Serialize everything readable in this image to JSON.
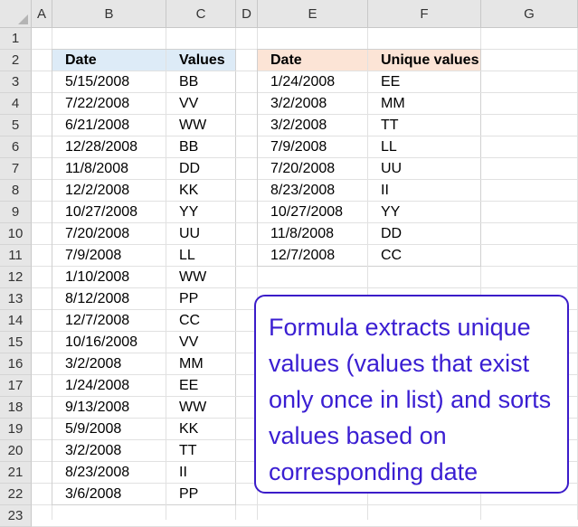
{
  "columns": [
    "A",
    "B",
    "C",
    "D",
    "E",
    "F",
    "G"
  ],
  "rows": [
    "1",
    "2",
    "3",
    "4",
    "5",
    "6",
    "7",
    "8",
    "9",
    "10",
    "11",
    "12",
    "13",
    "14",
    "15",
    "16",
    "17",
    "18",
    "19",
    "20",
    "21",
    "22",
    "23"
  ],
  "table1": {
    "headers": [
      "Date",
      "Values"
    ],
    "header_color": "#ddebf7",
    "rows": [
      [
        "5/15/2008",
        "BB"
      ],
      [
        "7/22/2008",
        "VV"
      ],
      [
        "6/21/2008",
        "WW"
      ],
      [
        "12/28/2008",
        "BB"
      ],
      [
        "11/8/2008",
        "DD"
      ],
      [
        "12/2/2008",
        "KK"
      ],
      [
        "10/27/2008",
        "YY"
      ],
      [
        "7/20/2008",
        "UU"
      ],
      [
        "7/9/2008",
        "LL"
      ],
      [
        "1/10/2008",
        "WW"
      ],
      [
        "8/12/2008",
        "PP"
      ],
      [
        "12/7/2008",
        "CC"
      ],
      [
        "10/16/2008",
        "VV"
      ],
      [
        "3/2/2008",
        "MM"
      ],
      [
        "1/24/2008",
        "EE"
      ],
      [
        "9/13/2008",
        "WW"
      ],
      [
        "5/9/2008",
        "KK"
      ],
      [
        "3/2/2008",
        "TT"
      ],
      [
        "8/23/2008",
        "II"
      ],
      [
        "3/6/2008",
        "PP"
      ]
    ]
  },
  "table2": {
    "headers": [
      "Date",
      "Unique values"
    ],
    "header_color": "#fce4d6",
    "rows": [
      [
        "1/24/2008",
        "EE"
      ],
      [
        "3/2/2008",
        "MM"
      ],
      [
        "3/2/2008",
        "TT"
      ],
      [
        "7/9/2008",
        "LL"
      ],
      [
        "7/20/2008",
        "UU"
      ],
      [
        "8/23/2008",
        "II"
      ],
      [
        "10/27/2008",
        "YY"
      ],
      [
        "11/8/2008",
        "DD"
      ],
      [
        "12/7/2008",
        "CC"
      ]
    ]
  },
  "note": {
    "text": "Formula extracts unique values (values that exist only once in list) and sorts values based on corresponding date",
    "color": "#3a1ed2",
    "border_color": "#3b1cc9"
  }
}
